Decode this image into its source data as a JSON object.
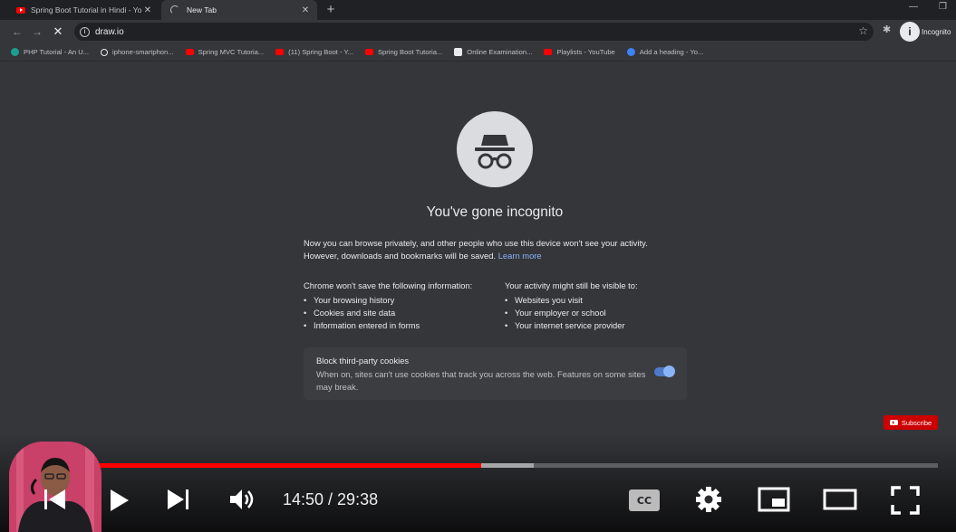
{
  "browser": {
    "tabs": [
      {
        "title": "Spring Boot Tutorial in Hindi - Yo",
        "active": false,
        "favicon": "youtube-icon"
      },
      {
        "title": "New Tab",
        "active": true,
        "favicon": "loading-spinner-icon"
      }
    ],
    "address": "draw.io",
    "profile_label": "Incognito",
    "bookmarks": [
      {
        "label": "PHP Tutorial - An U...",
        "icon": "teal-circle-icon"
      },
      {
        "label": "iphone-smartphon...",
        "icon": "globe-icon"
      },
      {
        "label": "Spring MVC Tutoria...",
        "icon": "youtube-icon"
      },
      {
        "label": "(11) Spring Boot - Y...",
        "icon": "youtube-icon"
      },
      {
        "label": "Spring Boot Tutoria...",
        "icon": "youtube-icon"
      },
      {
        "label": "Online Examination...",
        "icon": "document-icon"
      },
      {
        "label": "Playlists - YouTube",
        "icon": "youtube-icon"
      },
      {
        "label": "Add a heading - Yo...",
        "icon": "canva-icon"
      }
    ]
  },
  "incognito_page": {
    "heading": "You've gone incognito",
    "intro_line1": "Now you can browse privately, and other people who use this device won't see your activity.",
    "intro_line2": "However, downloads and bookmarks will be saved.",
    "learn_more": "Learn more",
    "left_title": "Chrome won't save the following information:",
    "left_items": [
      "Your browsing history",
      "Cookies and site data",
      "Information entered in forms"
    ],
    "right_title": "Your activity might still be visible to:",
    "right_items": [
      "Websites you visit",
      "Your employer or school",
      "Your internet service provider"
    ],
    "cookie_title": "Block third-party cookies",
    "cookie_desc": "When on, sites can't use cookies that track you across the web. Features on some sites may break.",
    "cookie_toggle_on": true
  },
  "player": {
    "subscribe_label": "Subscribe",
    "time_display": "14:50 / 29:38",
    "played_fraction": 0.502,
    "buffered_fraction": 0.56
  },
  "colors": {
    "accent_red": "#ff0000",
    "link_blue": "#8ab4f8",
    "page_bg": "#35363a"
  }
}
